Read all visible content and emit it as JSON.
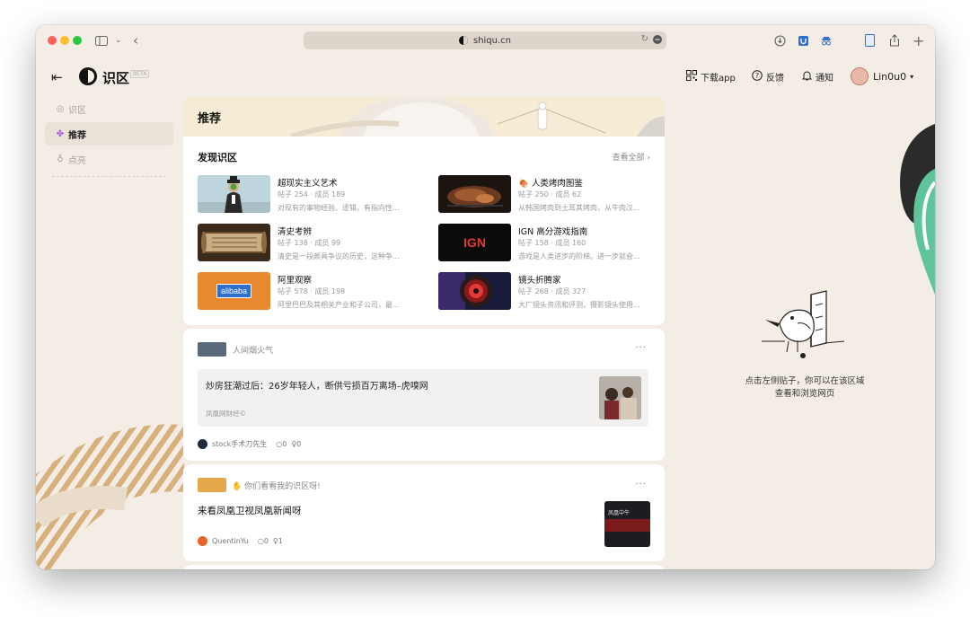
{
  "browser": {
    "url": "shiqu.cn"
  },
  "app": {
    "logo_text": "识区",
    "beta_label": "BETA"
  },
  "top_nav": {
    "download": "下载app",
    "feedback": "反馈",
    "notify": "通知",
    "username": "Lin0u0"
  },
  "sidebar": {
    "items": [
      {
        "label": "识区",
        "icon": "eye-icon"
      },
      {
        "label": "推荐",
        "icon": "sparkle-icon"
      },
      {
        "label": "点亮",
        "icon": "bulb-icon"
      }
    ]
  },
  "main": {
    "banner_title": "推荐",
    "discover": {
      "title": "发现识区",
      "more": "查看全部 ›",
      "communities": [
        {
          "name": "超现实主义艺术",
          "stats": "帖子 254 · 成员 189",
          "desc": "对现有的事物经验、逻辑，有指向性..."
        },
        {
          "name": "🍖 人类烤肉图鉴",
          "stats": "帖子 250 · 成员 62",
          "desc": "从韩国烤肉到土耳其烤肉，从牛肉汉..."
        },
        {
          "name": "清史考辨",
          "stats": "帖子 138 · 成员 99",
          "desc": "清史是一段颇具争议的历史，这种争..."
        },
        {
          "name": "IGN 高分游戏指南",
          "stats": "帖子 158 · 成员 160",
          "desc": "游戏是人类进步的阶梯。进一步就会..."
        },
        {
          "name": "阿里观察",
          "stats": "帖子 578 · 成员 198",
          "desc": "阿里巴巴及其相关产业和子公司，最..."
        },
        {
          "name": "镜头折腾家",
          "stats": "帖子 268 · 成员 327",
          "desc": "大厂镜头资讯和评测，摄影镜头使用..."
        }
      ],
      "thumb_labels": {
        "ign": "IGN",
        "alibaba": "alibaba"
      }
    },
    "posts": [
      {
        "community": "人间烟火气",
        "title": "炒房狂潮过后：26岁年轻人，断供亏损百万离场–虎嗅网",
        "source": "凤凰网财经©",
        "author": "stock手术刀先生",
        "comments": "0",
        "likes": "0",
        "more": "···"
      },
      {
        "community": "✋ 你们看看我的识区呀!",
        "title": "来看凤凰卫视凤凰新闻呀",
        "thumb_text": "凤凰中午",
        "author": "QuentinYu",
        "comments": "0",
        "likes": "1",
        "more": "···"
      }
    ]
  },
  "right_panel": {
    "hint_line1": "点击左侧贴子，你可以在该区域",
    "hint_line2": "查看和浏览网页"
  },
  "colors": {
    "window_bg": "#f4ede5",
    "card_bg": "#ffffff",
    "accent_green": "#5fc49a",
    "stripe_tan": "#d8b07e"
  }
}
